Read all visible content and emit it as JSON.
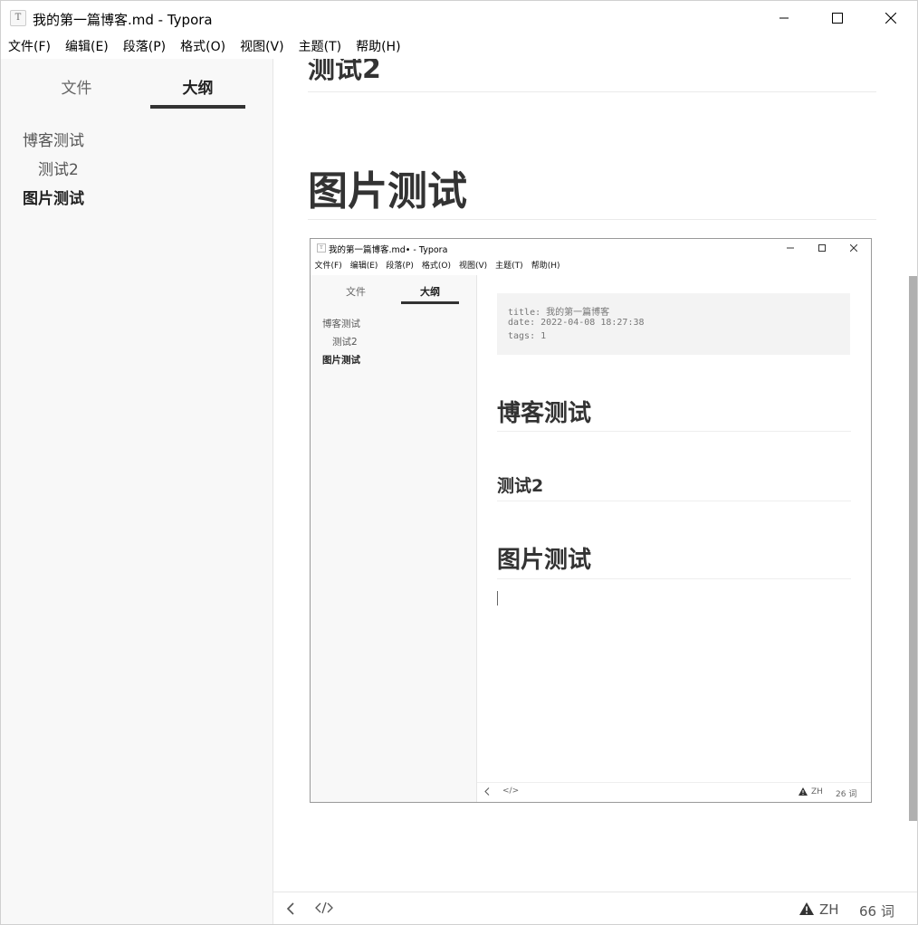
{
  "window": {
    "title": "我的第一篇博客.md - Typora",
    "app_icon": "T"
  },
  "menu": [
    "文件(F)",
    "编辑(E)",
    "段落(P)",
    "格式(O)",
    "视图(V)",
    "主题(T)",
    "帮助(H)"
  ],
  "sidebar": {
    "tabs": [
      {
        "label": "文件",
        "active": false
      },
      {
        "label": "大纲",
        "active": true
      }
    ],
    "outline": [
      {
        "label": "博客测试",
        "level": 1,
        "active": false
      },
      {
        "label": "测试2",
        "level": 2,
        "active": false
      },
      {
        "label": "图片测试",
        "level": 1,
        "active": true
      }
    ]
  },
  "editor": {
    "cut_heading": "测试2",
    "heading": "图片测试"
  },
  "embedded": {
    "title": "我的第一篇博客.md• - Typora",
    "app_icon": "T",
    "menu": [
      "文件(F)",
      "编辑(E)",
      "段落(P)",
      "格式(O)",
      "视图(V)",
      "主题(T)",
      "帮助(H)"
    ],
    "tabs": [
      "文件",
      "大纲"
    ],
    "outline": [
      "博客测试",
      "测试2",
      "图片测试"
    ],
    "front_matter": [
      "title: 我的第一篇博客",
      "date: 2022-04-08 18:27:38",
      "tags: 1"
    ],
    "headings": [
      "博客测试",
      "测试2",
      "图片测试"
    ],
    "status": {
      "lang": "ZH",
      "count": "26 词"
    }
  },
  "status": {
    "lang": "ZH",
    "word_count": "66 词"
  }
}
